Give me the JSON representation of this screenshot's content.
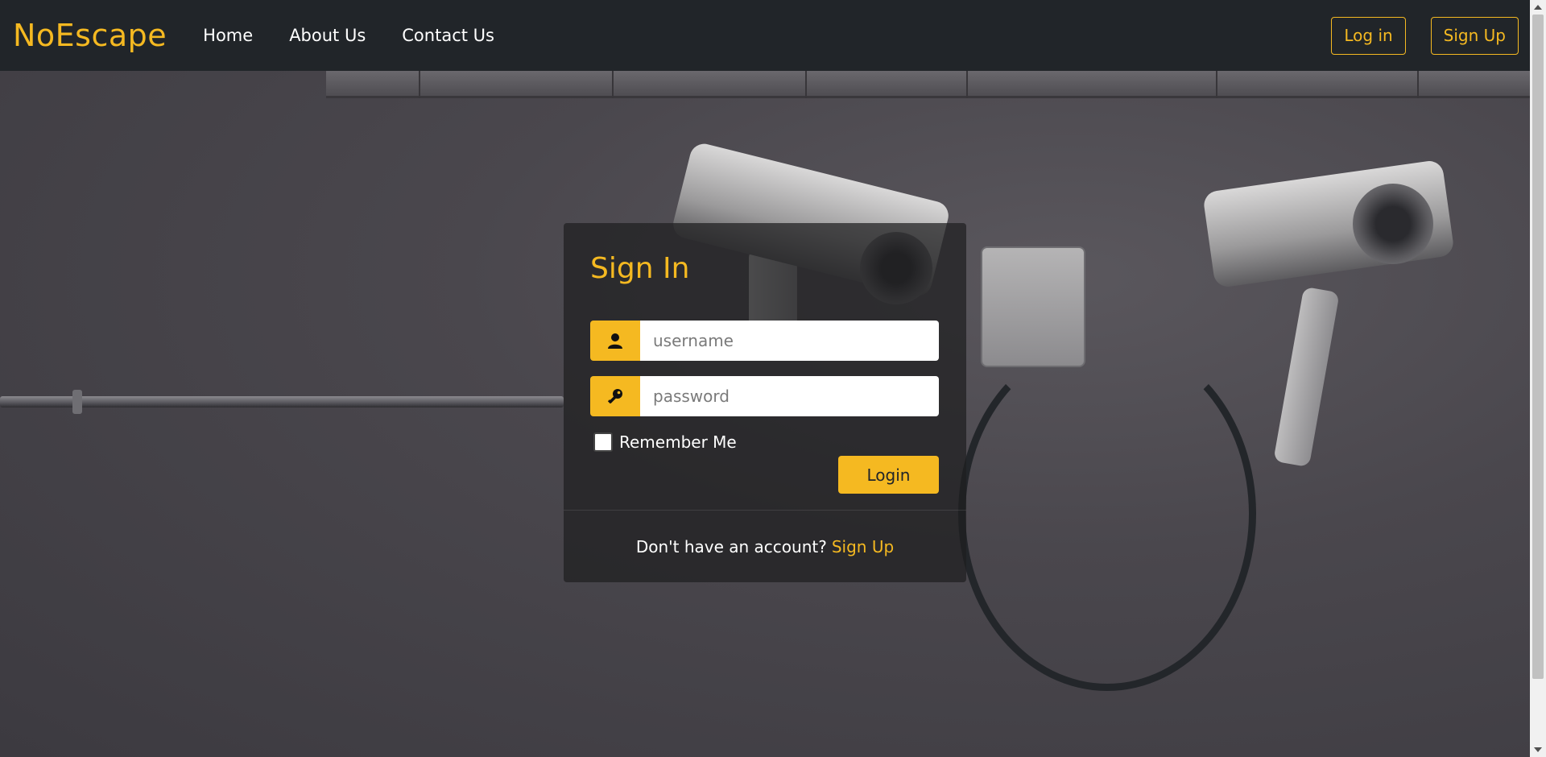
{
  "navbar": {
    "brand": "NoEscape",
    "links": [
      "Home",
      "About Us",
      "Contact Us"
    ],
    "login_label": "Log in",
    "signup_label": "Sign Up"
  },
  "signin": {
    "title": "Sign In",
    "username_placeholder": "username",
    "password_placeholder": "password",
    "username_icon": "user-icon",
    "password_icon": "key-icon",
    "remember_label": "Remember Me",
    "remember_checked": false,
    "login_label": "Login",
    "footer_text": "Don't have an account?",
    "footer_link": "Sign Up"
  },
  "colors": {
    "accent": "#f5b921",
    "navbar_bg": "#212529"
  }
}
